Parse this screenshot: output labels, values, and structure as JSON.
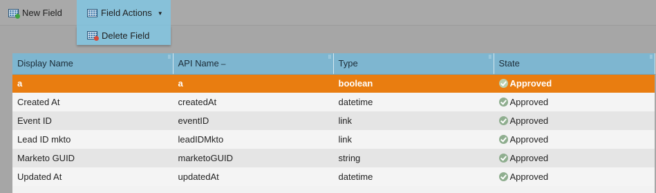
{
  "toolbar": {
    "new_field_label": "New Field",
    "field_actions_label": "Field Actions",
    "dropdown": {
      "delete_field_label": "Delete Field"
    }
  },
  "table": {
    "columns": [
      {
        "label": "Display Name",
        "sorted": false
      },
      {
        "label": "API Name",
        "sorted": true,
        "sort_indicator": "–"
      },
      {
        "label": "Type",
        "sorted": false
      },
      {
        "label": "State",
        "sorted": false
      }
    ],
    "rows": [
      {
        "display_name": "a",
        "api_name": "a",
        "type": "boolean",
        "state": "Approved",
        "selected": true
      },
      {
        "display_name": "Created At",
        "api_name": "createdAt",
        "type": "datetime",
        "state": "Approved",
        "selected": false
      },
      {
        "display_name": "Event ID",
        "api_name": "eventID",
        "type": "link",
        "state": "Approved",
        "selected": false
      },
      {
        "display_name": "Lead ID mkto",
        "api_name": "leadIDMkto",
        "type": "link",
        "state": "Approved",
        "selected": false
      },
      {
        "display_name": "Marketo GUID",
        "api_name": "marketoGUID",
        "type": "string",
        "state": "Approved",
        "selected": false
      },
      {
        "display_name": "Updated At",
        "api_name": "updatedAt",
        "type": "datetime",
        "state": "Approved",
        "selected": false
      }
    ]
  },
  "colors": {
    "toolbar_bg": "#a9a9a9",
    "active_menu_bg": "#87c1d9",
    "header_bg": "#7eb6d0",
    "selected_row_bg": "#e97d10",
    "approved_check": "#8fae8f"
  },
  "icons": {
    "new_field": "grid-add-icon",
    "field_actions": "grid-icon",
    "delete_field": "grid-delete-icon",
    "state": "check-circle-icon"
  }
}
